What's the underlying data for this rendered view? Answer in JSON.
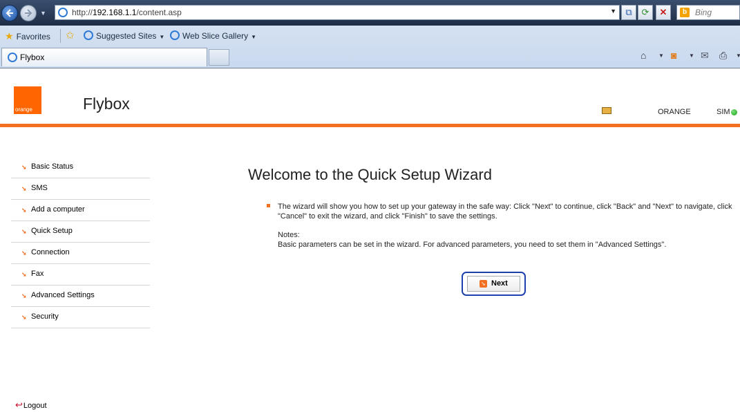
{
  "browser": {
    "url_prefix": "http://",
    "url_host": "192.168.1.1",
    "url_path": "/content.asp",
    "search_placeholder": "Bing",
    "favorites_label": "Favorites",
    "suggested_sites_label": "Suggested Sites",
    "webslice_gallery_label": "Web Slice Gallery",
    "tab_title": "Flybox"
  },
  "header": {
    "logo_text": "orange",
    "product_name": "Flybox",
    "operator": "ORANGE",
    "sim_label": "SIM",
    "sim_status_color": "#17a217",
    "accent_color": "#f36f21"
  },
  "sidebar": {
    "items": [
      {
        "label": "Basic Status"
      },
      {
        "label": "SMS"
      },
      {
        "label": "Add a computer"
      },
      {
        "label": "Quick Setup"
      },
      {
        "label": "Connection"
      },
      {
        "label": "Fax"
      },
      {
        "label": "Advanced Settings"
      },
      {
        "label": "Security"
      }
    ],
    "logout_label": "Logout"
  },
  "main": {
    "title": "Welcome to the Quick Setup Wizard",
    "intro": "The wizard will show you how to set up your gateway in the safe way: Click \"Next\" to continue, click \"Back\" and \"Next\" to navigate, click \"Cancel\" to exit the wizard, and click \"Finish\" to save the settings.",
    "notes_label": "Notes:",
    "notes_text": "Basic parameters can be set in the wizard. For advanced parameters, you need to set them in \"Advanced Settings\".",
    "next_label": "Next"
  }
}
